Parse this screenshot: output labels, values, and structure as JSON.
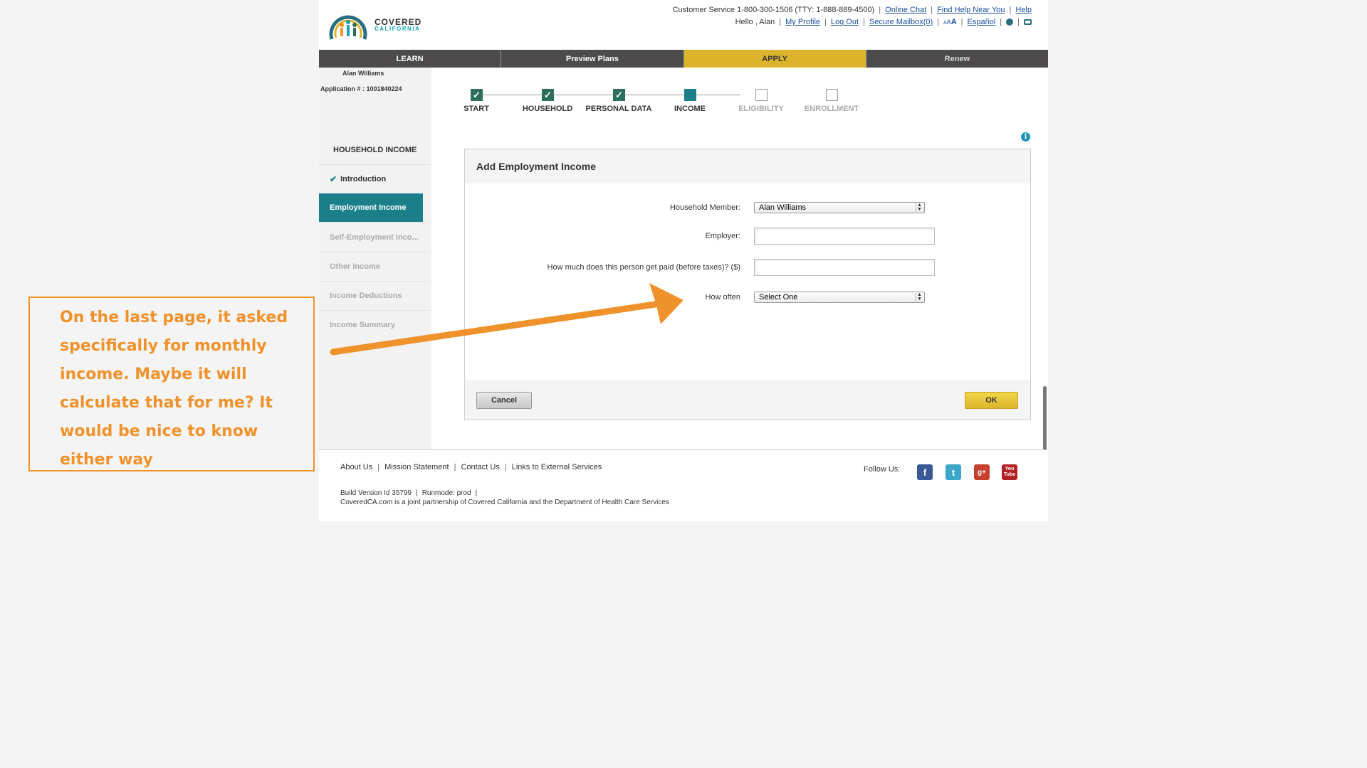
{
  "header": {
    "logo_line1": "COVERED",
    "logo_line2": "CALIFORNIA",
    "customer_service": "Customer Service 1-800-300-1506 (TTY: 1-888-889-4500)",
    "online_chat": "Online Chat",
    "find_help": "Find Help Near You",
    "help": "Help",
    "greeting": "Hello , Alan",
    "my_profile": "My Profile",
    "log_out": "Log Out",
    "secure_mailbox": "Secure Mailbox(0)",
    "font_small": "A",
    "font_medium": "A",
    "font_large": "A",
    "espanol": "Español"
  },
  "nav": {
    "tabs": [
      {
        "label": "LEARN"
      },
      {
        "label": "Preview Plans"
      },
      {
        "label": "APPLY"
      },
      {
        "label": "Renew"
      }
    ]
  },
  "applicant": {
    "name": "Alan Williams",
    "application_number": "Application # : 1001840224"
  },
  "sidebar": {
    "heading": "HOUSEHOLD INCOME",
    "items": [
      {
        "label": "Introduction",
        "state": "done"
      },
      {
        "label": "Employment Income",
        "state": "active"
      },
      {
        "label": "Self-Employment Inco...",
        "state": "future"
      },
      {
        "label": "Other Income",
        "state": "future"
      },
      {
        "label": "Income Deductions",
        "state": "future"
      },
      {
        "label": "Income Summary",
        "state": "future"
      }
    ]
  },
  "progress": {
    "steps": [
      {
        "label": "START",
        "state": "done"
      },
      {
        "label": "HOUSEHOLD",
        "state": "done"
      },
      {
        "label": "PERSONAL DATA",
        "state": "done"
      },
      {
        "label": "INCOME",
        "state": "current"
      },
      {
        "label": "ELIGIBILITY",
        "state": "future"
      },
      {
        "label": "ENROLLMENT",
        "state": "future"
      }
    ]
  },
  "form": {
    "title": "Add Employment Income",
    "household_member_label": "Household Member:",
    "household_member_value": "Alan Williams",
    "employer_label": "Employer:",
    "employer_value": "",
    "pay_label": "How much does this person get paid (before taxes)? ($)",
    "pay_value": "",
    "how_often_label": "How often",
    "how_often_value": "Select One",
    "cancel_label": "Cancel",
    "ok_label": "OK"
  },
  "footer": {
    "links": [
      "About Us",
      "Mission Statement",
      "Contact Us",
      "Links to External Services"
    ],
    "follow_us": "Follow Us:",
    "build_version": "Build Version Id 35799",
    "runmode": "Runmode: prod",
    "partnership": "CoveredCA.com is a joint partnership of Covered California and the Department of Health Care Services"
  },
  "annotation": {
    "text": "On the last page, it asked specifically for monthly income. Maybe it will calculate that for me? It would be nice to know either way"
  },
  "colors": {
    "teal": "#1b7f8a",
    "apply_yellow": "#dcb42c",
    "nav_dark": "#4d4a4b",
    "annotation_orange": "#f0922b"
  }
}
